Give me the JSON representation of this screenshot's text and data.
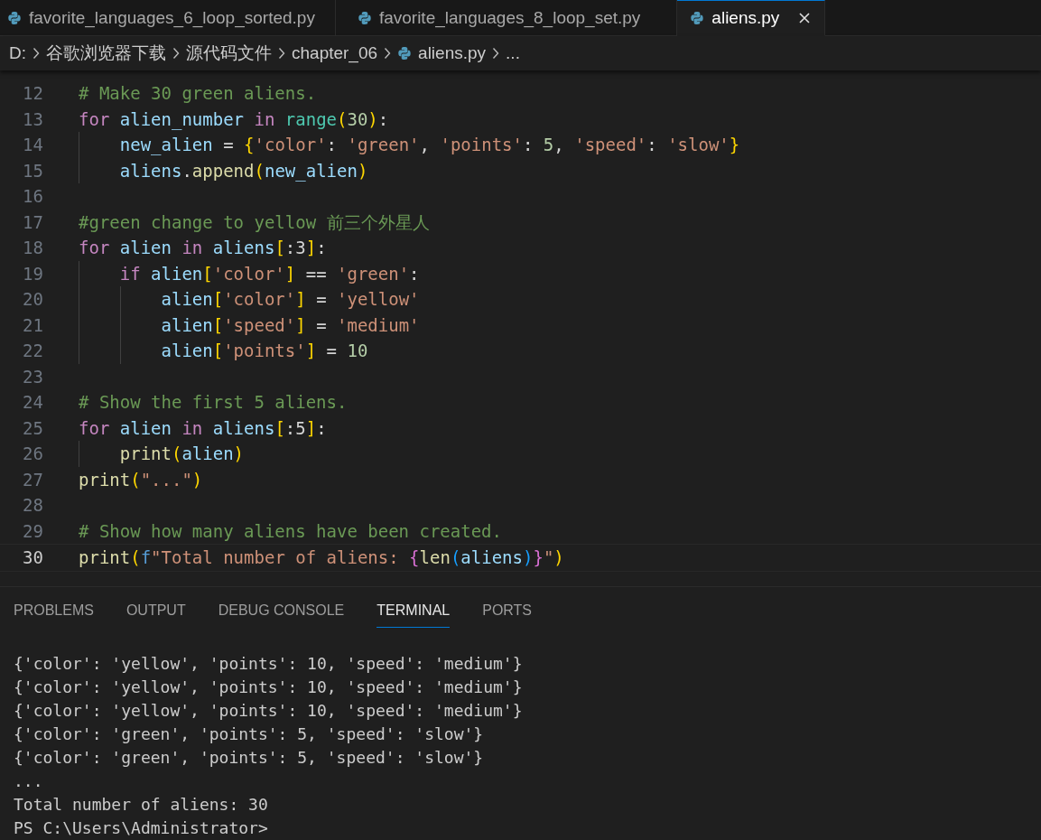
{
  "tabs": [
    {
      "label": "favorite_languages_6_loop_sorted.py",
      "selected": false
    },
    {
      "label": "favorite_languages_8_loop_set.py",
      "selected": false
    },
    {
      "label": "aliens.py",
      "selected": true
    }
  ],
  "breadcrumb": [
    {
      "label": "D:",
      "kind": "folder"
    },
    {
      "label": "谷歌浏览器下载",
      "kind": "folder"
    },
    {
      "label": "源代码文件",
      "kind": "folder"
    },
    {
      "label": "chapter_06",
      "kind": "folder"
    },
    {
      "label": "aliens.py",
      "kind": "file"
    },
    {
      "label": "...",
      "kind": "more"
    }
  ],
  "editor": {
    "lines": [
      {
        "number": "12",
        "current": false,
        "tokens": [
          {
            "kind": "comment",
            "text": "# Make 30 green aliens."
          }
        ]
      },
      {
        "number": "13",
        "current": false,
        "tokens": [
          {
            "kind": "keyword",
            "text": "for "
          },
          {
            "kind": "variable",
            "text": "alien_number "
          },
          {
            "kind": "keyword",
            "text": "in "
          },
          {
            "kind": "builtin",
            "text": "range"
          },
          {
            "kind": "bracket1",
            "text": "("
          },
          {
            "kind": "number",
            "text": "30"
          },
          {
            "kind": "bracket1",
            "text": ")"
          },
          {
            "kind": "punct",
            "text": ":"
          }
        ]
      },
      {
        "number": "14",
        "current": false,
        "tokens": [
          {
            "kind": "variable",
            "text": "    new_alien"
          },
          {
            "kind": "punct",
            "text": " = "
          },
          {
            "kind": "bracket1",
            "text": "{"
          },
          {
            "kind": "string",
            "text": "'color'"
          },
          {
            "kind": "punct",
            "text": ": "
          },
          {
            "kind": "string",
            "text": "'green'"
          },
          {
            "kind": "punct",
            "text": ", "
          },
          {
            "kind": "string",
            "text": "'points'"
          },
          {
            "kind": "punct",
            "text": ": "
          },
          {
            "kind": "number",
            "text": "5"
          },
          {
            "kind": "punct",
            "text": ", "
          },
          {
            "kind": "string",
            "text": "'speed'"
          },
          {
            "kind": "punct",
            "text": ": "
          },
          {
            "kind": "string",
            "text": "'slow'"
          },
          {
            "kind": "bracket1",
            "text": "}"
          }
        ]
      },
      {
        "number": "15",
        "current": false,
        "tokens": [
          {
            "kind": "variable",
            "text": "    aliens"
          },
          {
            "kind": "punct",
            "text": "."
          },
          {
            "kind": "function",
            "text": "append"
          },
          {
            "kind": "bracket1",
            "text": "("
          },
          {
            "kind": "variable",
            "text": "new_alien"
          },
          {
            "kind": "bracket1",
            "text": ")"
          }
        ]
      },
      {
        "number": "16",
        "current": false
      },
      {
        "number": "17",
        "current": false,
        "tokens": [
          {
            "kind": "comment",
            "text": "#green change to yellow 前三个外星人"
          }
        ]
      },
      {
        "number": "18",
        "current": false,
        "tokens": [
          {
            "kind": "keyword",
            "text": "for "
          },
          {
            "kind": "variable",
            "text": "alien "
          },
          {
            "kind": "keyword",
            "text": "in "
          },
          {
            "kind": "variable",
            "text": "aliens"
          },
          {
            "kind": "bracket1",
            "text": "["
          },
          {
            "kind": "punct",
            "text": ":3"
          },
          {
            "kind": "bracket1",
            "text": "]"
          },
          {
            "kind": "punct",
            "text": ":"
          }
        ]
      },
      {
        "number": "19",
        "current": false,
        "tokens": [
          {
            "kind": "keyword",
            "text": "    if "
          },
          {
            "kind": "variable",
            "text": "alien"
          },
          {
            "kind": "bracket1",
            "text": "["
          },
          {
            "kind": "string",
            "text": "'color'"
          },
          {
            "kind": "bracket1",
            "text": "]"
          },
          {
            "kind": "punct",
            "text": " == "
          },
          {
            "kind": "string",
            "text": "'green'"
          },
          {
            "kind": "punct",
            "text": ":"
          }
        ]
      },
      {
        "number": "20",
        "current": false,
        "tokens": [
          {
            "kind": "variable",
            "text": "        alien"
          },
          {
            "kind": "bracket1",
            "text": "["
          },
          {
            "kind": "string",
            "text": "'color'"
          },
          {
            "kind": "bracket1",
            "text": "]"
          },
          {
            "kind": "punct",
            "text": " = "
          },
          {
            "kind": "string",
            "text": "'yellow'"
          }
        ]
      },
      {
        "number": "21",
        "current": false,
        "tokens": [
          {
            "kind": "variable",
            "text": "        alien"
          },
          {
            "kind": "bracket1",
            "text": "["
          },
          {
            "kind": "string",
            "text": "'speed'"
          },
          {
            "kind": "bracket1",
            "text": "]"
          },
          {
            "kind": "punct",
            "text": " = "
          },
          {
            "kind": "string",
            "text": "'medium'"
          }
        ]
      },
      {
        "number": "22",
        "current": false,
        "tokens": [
          {
            "kind": "variable",
            "text": "        alien"
          },
          {
            "kind": "bracket1",
            "text": "["
          },
          {
            "kind": "string",
            "text": "'points'"
          },
          {
            "kind": "bracket1",
            "text": "]"
          },
          {
            "kind": "punct",
            "text": " = "
          },
          {
            "kind": "number",
            "text": "10"
          }
        ]
      },
      {
        "number": "23",
        "current": false
      },
      {
        "number": "24",
        "current": false,
        "tokens": [
          {
            "kind": "comment",
            "text": "# Show the first 5 aliens."
          }
        ]
      },
      {
        "number": "25",
        "current": false,
        "tokens": [
          {
            "kind": "keyword",
            "text": "for "
          },
          {
            "kind": "variable",
            "text": "alien "
          },
          {
            "kind": "keyword",
            "text": "in "
          },
          {
            "kind": "variable",
            "text": "aliens"
          },
          {
            "kind": "bracket1",
            "text": "["
          },
          {
            "kind": "punct",
            "text": ":5"
          },
          {
            "kind": "bracket1",
            "text": "]"
          },
          {
            "kind": "punct",
            "text": ":"
          }
        ]
      },
      {
        "number": "26",
        "current": false,
        "tokens": [
          {
            "kind": "function",
            "text": "    print"
          },
          {
            "kind": "bracket1",
            "text": "("
          },
          {
            "kind": "variable",
            "text": "alien"
          },
          {
            "kind": "bracket1",
            "text": ")"
          }
        ]
      },
      {
        "number": "27",
        "current": false,
        "tokens": [
          {
            "kind": "function",
            "text": "print"
          },
          {
            "kind": "bracket1",
            "text": "("
          },
          {
            "kind": "string",
            "text": "\"...\""
          },
          {
            "kind": "bracket1",
            "text": ")"
          }
        ]
      },
      {
        "number": "28",
        "current": false
      },
      {
        "number": "29",
        "current": false,
        "tokens": [
          {
            "kind": "comment",
            "text": "# Show how many aliens have been created."
          }
        ]
      },
      {
        "number": "30",
        "current": true,
        "tokens": [
          {
            "kind": "function",
            "text": "print"
          },
          {
            "kind": "bracket1",
            "text": "("
          },
          {
            "kind": "fprefix",
            "text": "f"
          },
          {
            "kind": "string",
            "text": "\"Total number of aliens: "
          },
          {
            "kind": "bracket2",
            "text": "{"
          },
          {
            "kind": "function",
            "text": "len"
          },
          {
            "kind": "bracket3",
            "text": "("
          },
          {
            "kind": "variable",
            "text": "aliens"
          },
          {
            "kind": "bracket3",
            "text": ")"
          },
          {
            "kind": "bracket2",
            "text": "}"
          },
          {
            "kind": "string",
            "text": "\""
          },
          {
            "kind": "bracket1",
            "text": ")"
          }
        ]
      }
    ]
  },
  "panel_tabs": [
    {
      "label": "PROBLEMS",
      "selected": false
    },
    {
      "label": "OUTPUT",
      "selected": false
    },
    {
      "label": "DEBUG CONSOLE",
      "selected": false
    },
    {
      "label": "TERMINAL",
      "selected": true
    },
    {
      "label": "PORTS",
      "selected": false
    }
  ],
  "terminal": {
    "lines": [
      "{'color': 'yellow', 'points': 10, 'speed': 'medium'}",
      "{'color': 'yellow', 'points': 10, 'speed': 'medium'}",
      "{'color': 'yellow', 'points': 10, 'speed': 'medium'}",
      "{'color': 'green', 'points': 5, 'speed': 'slow'}",
      "{'color': 'green', 'points': 5, 'speed': 'slow'}",
      "...",
      "Total number of aliens: 30",
      "PS C:\\Users\\Administrator>"
    ]
  }
}
